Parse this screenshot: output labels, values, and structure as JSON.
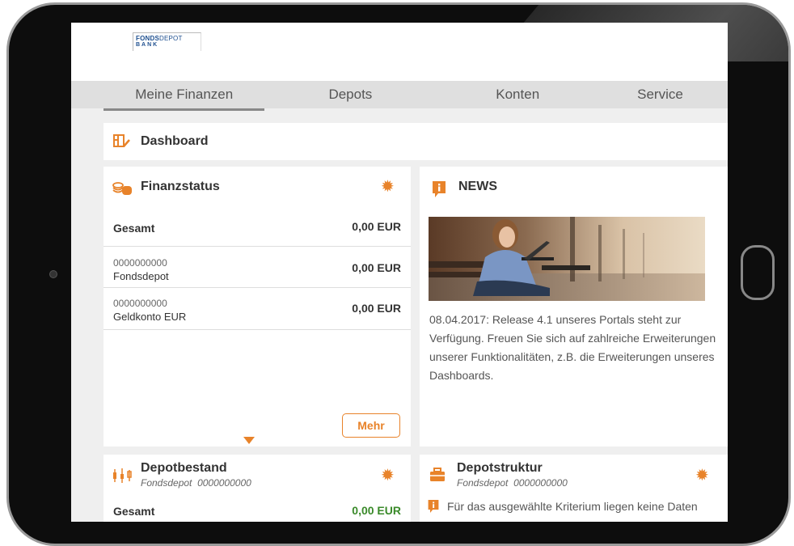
{
  "logo": {
    "line1_bold": "FONDS",
    "line1_rest": "DEPOT",
    "line2": "BANK"
  },
  "nav": {
    "tabs": [
      {
        "label": "Meine Finanzen"
      },
      {
        "label": "Depots"
      },
      {
        "label": "Konten"
      },
      {
        "label": "Service"
      }
    ]
  },
  "dashboard": {
    "title": "Dashboard"
  },
  "finanzstatus": {
    "title": "Finanzstatus",
    "total_label": "Gesamt",
    "total_value": "0,00 EUR",
    "accounts": [
      {
        "number": "0000000000",
        "name": "Fondsdepot",
        "value": "0,00 EUR"
      },
      {
        "number": "0000000000",
        "name": "Geldkonto EUR",
        "value": "0,00 EUR"
      }
    ],
    "more_label": "Mehr"
  },
  "news": {
    "title": "NEWS",
    "text": "08.04.2017: Release 4.1 unseres Portals steht zur Verfügung. Freuen Sie sich auf zahlreiche Erweiterungen unserer Funktionalitäten, z.B. die Erweiterungen unseres Dashboards."
  },
  "depotbestand": {
    "title": "Depotbestand",
    "subtitle_type": "Fondsdepot",
    "subtitle_number": "0000000000",
    "total_label": "Gesamt",
    "total_value": "0,00 EUR"
  },
  "depotstruktur": {
    "title": "Depotstruktur",
    "subtitle_type": "Fondsdepot",
    "subtitle_number": "0000000000",
    "notice": "Für das ausgewählte Kriterium liegen keine Daten"
  },
  "colors": {
    "accent": "#e8832a",
    "positive": "#3a8a2a",
    "nav_bg": "#dfdfdf"
  }
}
